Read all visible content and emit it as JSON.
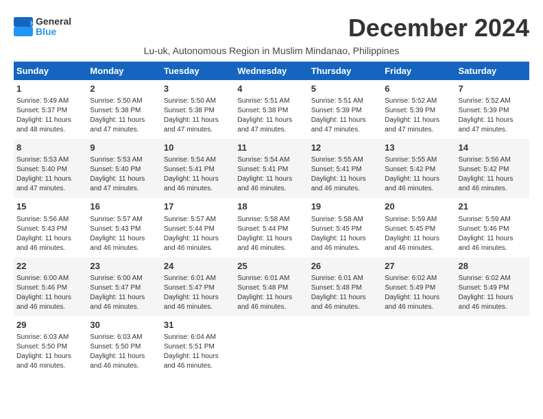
{
  "logo": {
    "general": "General",
    "blue": "Blue"
  },
  "title": "December 2024",
  "subtitle": "Lu-uk, Autonomous Region in Muslim Mindanao, Philippines",
  "days_header": [
    "Sunday",
    "Monday",
    "Tuesday",
    "Wednesday",
    "Thursday",
    "Friday",
    "Saturday"
  ],
  "weeks": [
    [
      {
        "day": "1",
        "info": "Sunrise: 5:49 AM\nSunset: 5:37 PM\nDaylight: 11 hours\nand 48 minutes."
      },
      {
        "day": "2",
        "info": "Sunrise: 5:50 AM\nSunset: 5:38 PM\nDaylight: 11 hours\nand 47 minutes."
      },
      {
        "day": "3",
        "info": "Sunrise: 5:50 AM\nSunset: 5:38 PM\nDaylight: 11 hours\nand 47 minutes."
      },
      {
        "day": "4",
        "info": "Sunrise: 5:51 AM\nSunset: 5:38 PM\nDaylight: 11 hours\nand 47 minutes."
      },
      {
        "day": "5",
        "info": "Sunrise: 5:51 AM\nSunset: 5:39 PM\nDaylight: 11 hours\nand 47 minutes."
      },
      {
        "day": "6",
        "info": "Sunrise: 5:52 AM\nSunset: 5:39 PM\nDaylight: 11 hours\nand 47 minutes."
      },
      {
        "day": "7",
        "info": "Sunrise: 5:52 AM\nSunset: 5:39 PM\nDaylight: 11 hours\nand 47 minutes."
      }
    ],
    [
      {
        "day": "8",
        "info": "Sunrise: 5:53 AM\nSunset: 5:40 PM\nDaylight: 11 hours\nand 47 minutes."
      },
      {
        "day": "9",
        "info": "Sunrise: 5:53 AM\nSunset: 5:40 PM\nDaylight: 11 hours\nand 47 minutes."
      },
      {
        "day": "10",
        "info": "Sunrise: 5:54 AM\nSunset: 5:41 PM\nDaylight: 11 hours\nand 46 minutes."
      },
      {
        "day": "11",
        "info": "Sunrise: 5:54 AM\nSunset: 5:41 PM\nDaylight: 11 hours\nand 46 minutes."
      },
      {
        "day": "12",
        "info": "Sunrise: 5:55 AM\nSunset: 5:41 PM\nDaylight: 11 hours\nand 46 minutes."
      },
      {
        "day": "13",
        "info": "Sunrise: 5:55 AM\nSunset: 5:42 PM\nDaylight: 11 hours\nand 46 minutes."
      },
      {
        "day": "14",
        "info": "Sunrise: 5:56 AM\nSunset: 5:42 PM\nDaylight: 11 hours\nand 46 minutes."
      }
    ],
    [
      {
        "day": "15",
        "info": "Sunrise: 5:56 AM\nSunset: 5:43 PM\nDaylight: 11 hours\nand 46 minutes."
      },
      {
        "day": "16",
        "info": "Sunrise: 5:57 AM\nSunset: 5:43 PM\nDaylight: 11 hours\nand 46 minutes."
      },
      {
        "day": "17",
        "info": "Sunrise: 5:57 AM\nSunset: 5:44 PM\nDaylight: 11 hours\nand 46 minutes."
      },
      {
        "day": "18",
        "info": "Sunrise: 5:58 AM\nSunset: 5:44 PM\nDaylight: 11 hours\nand 46 minutes."
      },
      {
        "day": "19",
        "info": "Sunrise: 5:58 AM\nSunset: 5:45 PM\nDaylight: 11 hours\nand 46 minutes."
      },
      {
        "day": "20",
        "info": "Sunrise: 5:59 AM\nSunset: 5:45 PM\nDaylight: 11 hours\nand 46 minutes."
      },
      {
        "day": "21",
        "info": "Sunrise: 5:59 AM\nSunset: 5:46 PM\nDaylight: 11 hours\nand 46 minutes."
      }
    ],
    [
      {
        "day": "22",
        "info": "Sunrise: 6:00 AM\nSunset: 5:46 PM\nDaylight: 11 hours\nand 46 minutes."
      },
      {
        "day": "23",
        "info": "Sunrise: 6:00 AM\nSunset: 5:47 PM\nDaylight: 11 hours\nand 46 minutes."
      },
      {
        "day": "24",
        "info": "Sunrise: 6:01 AM\nSunset: 5:47 PM\nDaylight: 11 hours\nand 46 minutes."
      },
      {
        "day": "25",
        "info": "Sunrise: 6:01 AM\nSunset: 5:48 PM\nDaylight: 11 hours\nand 46 minutes."
      },
      {
        "day": "26",
        "info": "Sunrise: 6:01 AM\nSunset: 5:48 PM\nDaylight: 11 hours\nand 46 minutes."
      },
      {
        "day": "27",
        "info": "Sunrise: 6:02 AM\nSunset: 5:49 PM\nDaylight: 11 hours\nand 46 minutes."
      },
      {
        "day": "28",
        "info": "Sunrise: 6:02 AM\nSunset: 5:49 PM\nDaylight: 11 hours\nand 46 minutes."
      }
    ],
    [
      {
        "day": "29",
        "info": "Sunrise: 6:03 AM\nSunset: 5:50 PM\nDaylight: 11 hours\nand 46 minutes."
      },
      {
        "day": "30",
        "info": "Sunrise: 6:03 AM\nSunset: 5:50 PM\nDaylight: 11 hours\nand 46 minutes."
      },
      {
        "day": "31",
        "info": "Sunrise: 6:04 AM\nSunset: 5:51 PM\nDaylight: 11 hours\nand 46 minutes."
      },
      {
        "day": "",
        "info": ""
      },
      {
        "day": "",
        "info": ""
      },
      {
        "day": "",
        "info": ""
      },
      {
        "day": "",
        "info": ""
      }
    ]
  ]
}
